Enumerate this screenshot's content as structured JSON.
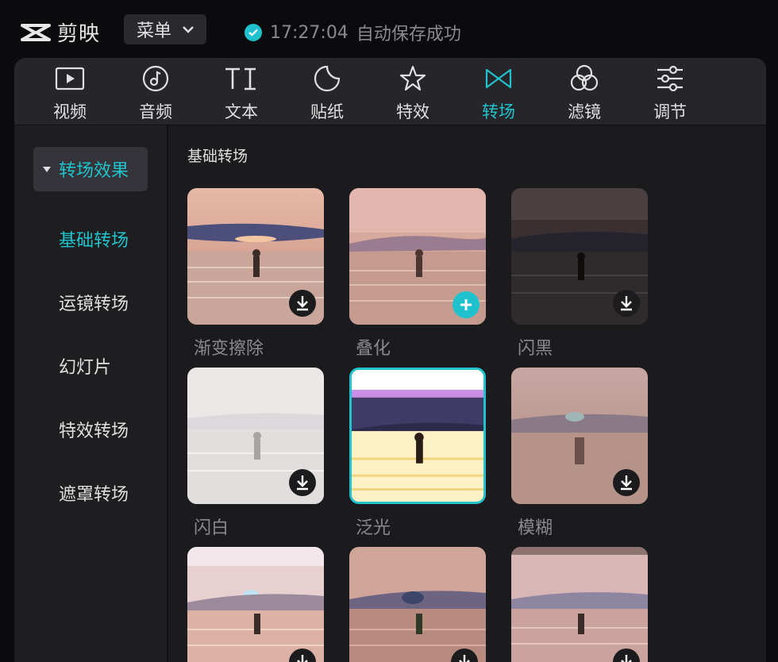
{
  "app": {
    "name": "剪映",
    "menu_label": "菜单",
    "save_time": "17:27:04",
    "save_text": "自动保存成功"
  },
  "tabs": [
    {
      "label": "视频",
      "icon": "video-icon"
    },
    {
      "label": "音频",
      "icon": "audio-icon"
    },
    {
      "label": "文本",
      "icon": "text-icon"
    },
    {
      "label": "贴纸",
      "icon": "sticker-icon"
    },
    {
      "label": "特效",
      "icon": "effects-icon"
    },
    {
      "label": "转场",
      "icon": "transition-icon",
      "active": true
    },
    {
      "label": "滤镜",
      "icon": "filter-icon"
    },
    {
      "label": "调节",
      "icon": "adjust-icon"
    }
  ],
  "sidebar": {
    "category": "转场效果",
    "items": [
      {
        "label": "基础转场",
        "active": true
      },
      {
        "label": "运镜转场"
      },
      {
        "label": "幻灯片"
      },
      {
        "label": "特效转场"
      },
      {
        "label": "遮罩转场"
      }
    ]
  },
  "content": {
    "section_title": "基础转场",
    "cards": [
      {
        "label": "渐变擦除",
        "action": "download"
      },
      {
        "label": "叠化",
        "action": "add"
      },
      {
        "label": "闪黑",
        "action": "download"
      },
      {
        "label": "闪白",
        "action": "download"
      },
      {
        "label": "泛光",
        "action": "none",
        "selected": true
      },
      {
        "label": "模糊",
        "action": "download"
      },
      {
        "label": "",
        "action": "download"
      },
      {
        "label": "",
        "action": "download"
      },
      {
        "label": "",
        "action": "download"
      }
    ]
  },
  "colors": {
    "accent": "#20c3cc",
    "background": "#0b0b0d",
    "panel": "#1b1b1d"
  }
}
